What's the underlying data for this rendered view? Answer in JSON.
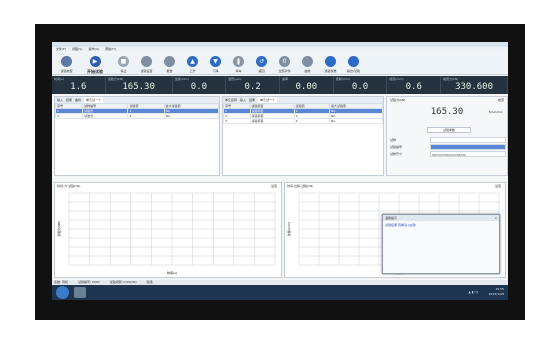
{
  "menubar": [
    "文件(F)",
    "视图(V)",
    "操作(O)",
    "帮助(H)"
  ],
  "toolbar": [
    {
      "label": "试验类型",
      "icon": "clipboard-icon",
      "color": "#5b7aa8"
    },
    {
      "label": "开始试验",
      "icon": "play-icon",
      "color": "#2f5fae",
      "big": true
    },
    {
      "label": "停止",
      "icon": "stop-icon",
      "color": "#9aa6b2"
    },
    {
      "label": "试验设置",
      "icon": "settings-icon",
      "color": "#7f8fa2"
    },
    {
      "label": "报告",
      "icon": "report-icon",
      "color": "#7f8fa2"
    },
    {
      "label": "上升",
      "icon": "arrow-up-icon",
      "color": "#2b6cc4"
    },
    {
      "label": "下降",
      "icon": "arrow-down-icon",
      "color": "#2b6cc4"
    },
    {
      "label": "停车",
      "icon": "pause-icon",
      "color": "#8a97a6"
    },
    {
      "label": "返回",
      "icon": "return-icon",
      "color": "#2b6cc4"
    },
    {
      "label": "全部清零",
      "icon": "reset-icon",
      "color": "#7f8fa2"
    },
    {
      "label": "曲线",
      "icon": "curve-icon",
      "color": "#7f8fa2"
    },
    {
      "label": "通道校准",
      "icon": "calibrate-icon",
      "color": "#2b6cc4"
    },
    {
      "label": "输出/试验",
      "icon": "output-icon",
      "color": "#2b6cc4"
    }
  ],
  "readouts": [
    {
      "caption": "时间(s)",
      "value": "1.6"
    },
    {
      "caption": "试验力(kN)",
      "value": "165.30",
      "wide": true
    },
    {
      "caption": "位移(mm)",
      "value": "0.0"
    },
    {
      "caption": "变形(μm)",
      "value": "0.2"
    },
    {
      "caption": "速率",
      "value": "0.00"
    },
    {
      "caption": "控制(mm)",
      "value": "0.0"
    },
    {
      "caption": "峰值(mm)",
      "value": "0.6"
    },
    {
      "caption": "峰值力(kN)",
      "value": "330.600",
      "wide": true
    }
  ],
  "table1": {
    "tabs": [
      "输入",
      "结果",
      "曲线"
    ],
    "active_tab": "单元试一个",
    "headers": [
      "序号",
      "试样编号",
      "试验值",
      "最大试验值"
    ],
    "rows": [
      [
        "1",
        "试验式",
        "2",
        "NA"
      ],
      [
        "2",
        "试验式",
        "2",
        "NA"
      ]
    ]
  },
  "table2": {
    "tabs": [
      "单元名称",
      "输入",
      "结果"
    ],
    "active_tab": "单元试一个",
    "headers": [
      "序号",
      "试验项目",
      "试验值",
      "最大试验值"
    ],
    "rows": [
      [
        "1",
        "试验项目",
        "2",
        "NA"
      ],
      [
        "2",
        "试验项目",
        "2",
        "NA"
      ],
      [
        "3",
        "试验项目",
        "2",
        "NA"
      ]
    ]
  },
  "side": {
    "title": "试验力(kN)",
    "right": "峰值",
    "value": "165.30",
    "unit": "5mm/min",
    "button": "试验参数",
    "rows": [
      {
        "k": "试样",
        "v": ""
      },
      {
        "k": "试验编号",
        "v": ""
      },
      {
        "k": "试样尺寸",
        "v": "50mm×50mm×50mm"
      }
    ]
  },
  "chart1": {
    "tab": "时间-力 试验(kN)",
    "setting": "设置",
    "xlabel": "时间(s)",
    "ylabel": "试验力(kN)"
  },
  "chart2": {
    "tab": "时间-位移 试验(kN)",
    "setting": "设置",
    "xlabel": "时间(s)",
    "ylabel": "位移(mm)"
  },
  "popup": {
    "title": "温馨提示",
    "text": "试验结果 查看请 (右键)"
  },
  "status": [
    "系统: 待机",
    "试验编号: 0000",
    "试验间隔: 0.00(kN)",
    "就绪"
  ],
  "clock": {
    "time": "15:55",
    "date": "2015/1/28"
  }
}
